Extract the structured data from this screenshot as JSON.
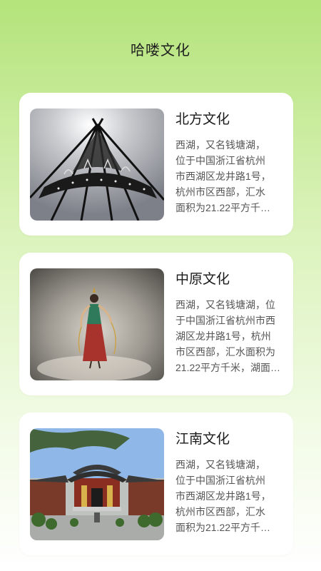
{
  "page": {
    "title": "哈喽文化"
  },
  "cards": [
    {
      "title": "北方文化",
      "desc_lines": [
        "西湖，又名钱塘湖，",
        "位于中国浙江省杭州",
        "市西湖区龙井路1号，",
        "杭州市区西部，汇水",
        "面积为21.22平方千…"
      ]
    },
    {
      "title": "中原文化",
      "desc_lines": [
        "西湖，又名钱塘湖，位",
        "于中国浙江省杭州市西",
        "湖区龙井路1号，杭州",
        "市区西部，汇水面积为",
        "21.22平方千米，湖面…"
      ]
    },
    {
      "title": "江南文化",
      "desc_lines": [
        "西湖，又名钱塘湖，",
        "位于中国浙江省杭州",
        "市西湖区龙井路1号，",
        "杭州市区西部，汇水",
        "面积为21.22平方千…"
      ]
    }
  ]
}
